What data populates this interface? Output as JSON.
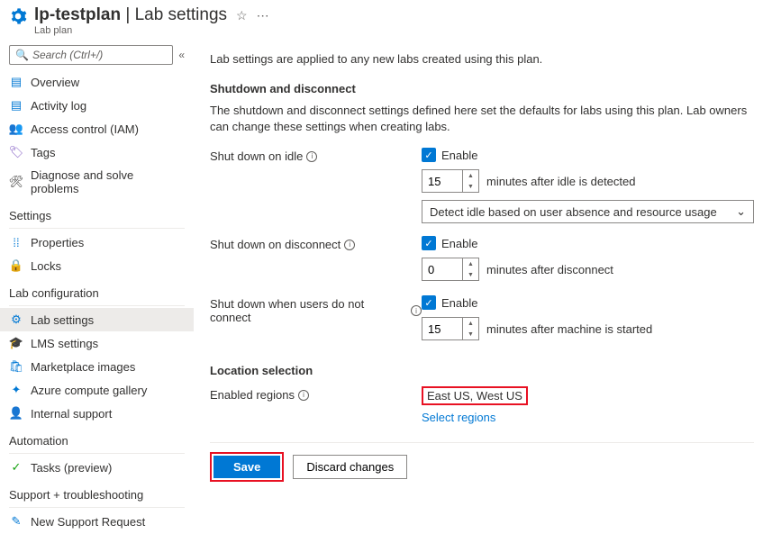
{
  "header": {
    "name": "lp-testplan",
    "separator": " | ",
    "page": "Lab settings",
    "subtitle": "Lab plan"
  },
  "sidebar": {
    "search_placeholder": "Search (Ctrl+/)",
    "groups": [
      {
        "header": null,
        "items": [
          {
            "id": "overview",
            "label": "Overview",
            "icon": "▤",
            "color": "#0078d4"
          },
          {
            "id": "activity",
            "label": "Activity log",
            "icon": "▤",
            "color": "#0078d4"
          },
          {
            "id": "access",
            "label": "Access control (IAM)",
            "icon": "👥",
            "color": "#0078d4"
          },
          {
            "id": "tags",
            "label": "Tags",
            "icon": "🏷",
            "color": "#8661c5"
          },
          {
            "id": "diagnose",
            "label": "Diagnose and solve problems",
            "icon": "🛠",
            "color": "#323130"
          }
        ]
      },
      {
        "header": "Settings",
        "items": [
          {
            "id": "properties",
            "label": "Properties",
            "icon": "⁞⁞",
            "color": "#0078d4"
          },
          {
            "id": "locks",
            "label": "Locks",
            "icon": "🔒",
            "color": "#323130"
          }
        ]
      },
      {
        "header": "Lab configuration",
        "items": [
          {
            "id": "lab-settings",
            "label": "Lab settings",
            "icon": "⚙",
            "color": "#0078d4",
            "active": true
          },
          {
            "id": "lms",
            "label": "LMS settings",
            "icon": "🎓",
            "color": "#323130"
          },
          {
            "id": "marketplace",
            "label": "Marketplace images",
            "icon": "🛍",
            "color": "#0078d4"
          },
          {
            "id": "gallery",
            "label": "Azure compute gallery",
            "icon": "✦",
            "color": "#0078d4"
          },
          {
            "id": "support",
            "label": "Internal support",
            "icon": "👤",
            "color": "#8661c5"
          }
        ]
      },
      {
        "header": "Automation",
        "items": [
          {
            "id": "tasks",
            "label": "Tasks (preview)",
            "icon": "✓",
            "color": "#13a10e"
          }
        ]
      },
      {
        "header": "Support + troubleshooting",
        "items": [
          {
            "id": "new-support",
            "label": "New Support Request",
            "icon": "✎",
            "color": "#0078d4"
          }
        ]
      }
    ]
  },
  "main": {
    "intro": "Lab settings are applied to any new labs created using this plan.",
    "shutdown": {
      "heading": "Shutdown and disconnect",
      "desc": "The shutdown and disconnect settings defined here set the defaults for labs using this plan. Lab owners can change these settings when creating labs.",
      "idle": {
        "label": "Shut down on idle",
        "enable": "Enable",
        "value": "15",
        "suffix": "minutes after idle is detected",
        "dropdown": "Detect idle based on user absence and resource usage"
      },
      "disconnect": {
        "label": "Shut down on disconnect",
        "enable": "Enable",
        "value": "0",
        "suffix": "minutes after disconnect"
      },
      "noconnect": {
        "label": "Shut down when users do not connect",
        "enable": "Enable",
        "value": "15",
        "suffix": "minutes after machine is started"
      }
    },
    "location": {
      "heading": "Location selection",
      "label": "Enabled regions",
      "value": "East US, West US",
      "link": "Select regions"
    },
    "footer": {
      "save": "Save",
      "discard": "Discard changes"
    }
  }
}
